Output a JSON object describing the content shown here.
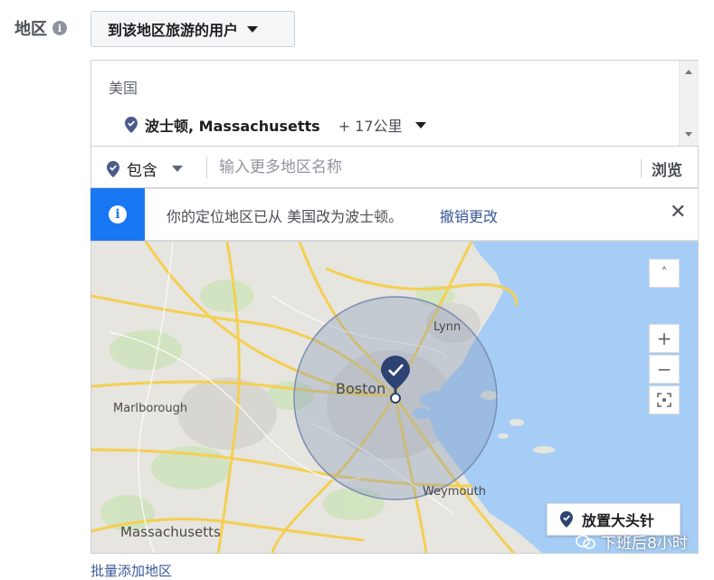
{
  "header": {
    "region_label": "地区",
    "info_icon": "info-icon",
    "audience_select": "到该地区旅游的用户"
  },
  "locations": {
    "country": "美国",
    "selected": {
      "name": "波士顿, Massachusetts",
      "radius": "+ 17公里"
    }
  },
  "include": {
    "mode": "包含",
    "search_placeholder": "输入更多地区名称",
    "browse_label": "浏览"
  },
  "notice": {
    "text": "你的定位地区已从 美国改为波士顿。",
    "undo_label": "撤销更改",
    "close_icon": "close-icon"
  },
  "map": {
    "labels": {
      "boston": "Boston",
      "lynn": "Lynn",
      "marlborough": "Marlborough",
      "weymouth": "Weymouth",
      "massachusetts": "Massachusetts"
    },
    "controls": {
      "collapse": "˄",
      "zoom_in": "+",
      "zoom_out": "−"
    },
    "drop_pin_label": "放置大头针",
    "colors": {
      "land": "#e6e4df",
      "water": "#a6cdf5",
      "highway": "#f4cf52",
      "radius_fill": "#8c9dbd",
      "pin": "#2d4373"
    }
  },
  "watermark": "下班后8小时",
  "bulk_add_label": "批量添加地区"
}
